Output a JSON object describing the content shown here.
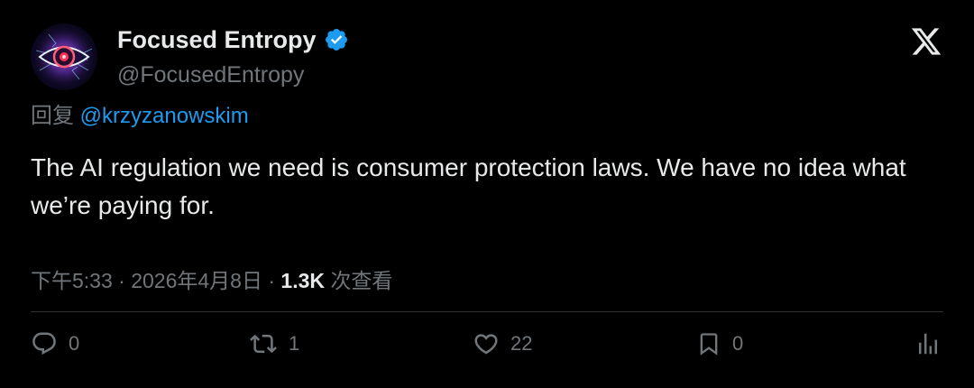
{
  "author": {
    "display_name": "Focused Entropy",
    "handle": "@FocusedEntropy",
    "verified": true
  },
  "reply": {
    "prefix": "回复",
    "to": "@krzyzanowskim"
  },
  "tweet": {
    "text": "The AI regulation we need is consumer protection laws. We have no idea what we’re paying for."
  },
  "meta": {
    "time": "下午5:33",
    "separator": "·",
    "date": "2026年4月8日",
    "views_count": "1.3K",
    "views_label": "次查看"
  },
  "actions": {
    "replies": "0",
    "reposts": "1",
    "likes": "22",
    "bookmarks": "0"
  },
  "icons": {
    "avatar": "eye-avatar",
    "verified": "verified-badge-icon",
    "brand": "x-logo-icon",
    "reply": "reply-icon",
    "repost": "repost-icon",
    "like": "heart-icon",
    "bookmark": "bookmark-icon",
    "share": "analytics-icon"
  },
  "colors": {
    "background": "#000000",
    "text": "#e7e9ea",
    "muted": "#71767b",
    "link": "#1d9bf0",
    "divider": "#2f3336"
  }
}
